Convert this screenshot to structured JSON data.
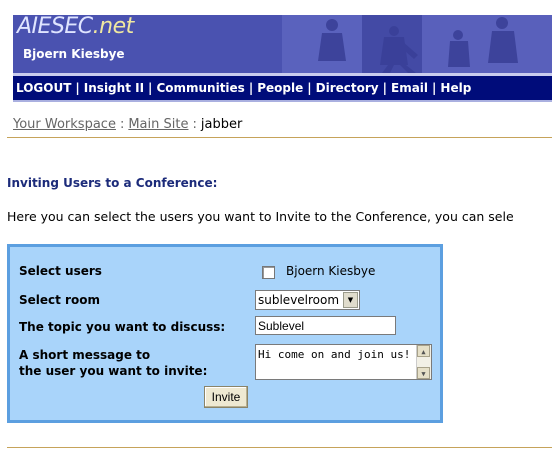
{
  "header": {
    "brand_main": "AIESEC",
    "brand_suffix": ".net",
    "username": "Bjoern Kiesbye"
  },
  "nav": {
    "items": [
      "LOGOUT",
      "Insight II",
      "Communities",
      "People",
      "Directory",
      "Email",
      "Help"
    ],
    "separator": "|"
  },
  "breadcrumb": {
    "workspace": "Your Workspace",
    "main_site": "Main Site",
    "current": "jabber",
    "separator": ":"
  },
  "page": {
    "heading": "Inviting Users to a Conference:",
    "intro": "Here you can select the users you want to Invite to the Conference, you can sele"
  },
  "form": {
    "select_users_label": "Select users",
    "user_option": "Bjoern Kiesbye",
    "user_checked": false,
    "select_room_label": "Select room",
    "room_value": "sublevelroom",
    "topic_label": "The topic you want to discuss:",
    "topic_value": "Sublevel",
    "message_label_line1": "A short message to",
    "message_label_line2": "the user you want to invite:",
    "message_value": "Hi come on and join us!",
    "invite_button": "Invite"
  },
  "colors": {
    "banner": "#4a52b0",
    "navbar": "#000c7a",
    "panel": "#a9d4fa",
    "panel_border": "#5c9fe0",
    "rule": "#c6a35a"
  }
}
